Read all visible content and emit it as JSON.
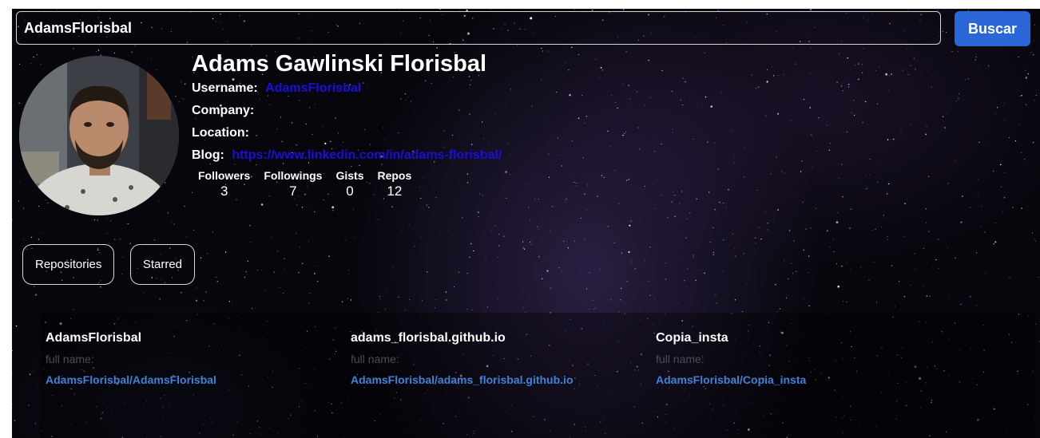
{
  "search": {
    "value": "AdamsFlorisbal",
    "button_label": "Buscar"
  },
  "profile": {
    "name": "Adams Gawlinski Florisbal",
    "username_label": "Username:",
    "username": "AdamsFlorisbal",
    "company_label": "Company:",
    "company": "",
    "location_label": "Location:",
    "location": "",
    "blog_label": "Blog:",
    "blog": "https://www.linkedin.com/in/adams-florisbal/"
  },
  "stats": [
    {
      "label": "Followers",
      "value": "3"
    },
    {
      "label": "Followings",
      "value": "7"
    },
    {
      "label": "Gists",
      "value": "0"
    },
    {
      "label": "Repos",
      "value": "12"
    }
  ],
  "tabs": [
    {
      "label": "Repositories"
    },
    {
      "label": "Starred"
    }
  ],
  "repos": [
    {
      "name": "AdamsFlorisbal",
      "fullname_label": "full name:",
      "link": "AdamsFlorisbal/AdamsFlorisbal"
    },
    {
      "name": "adams_florisbal.github.io",
      "fullname_label": "full name:",
      "link": "AdamsFlorisbal/adams_florisbal.github.io"
    },
    {
      "name": "Copia_insta",
      "fullname_label": "full name:",
      "link": "AdamsFlorisbal/Copia_insta"
    }
  ],
  "colors": {
    "accent": "#2b66d9",
    "link": "#1a0fd9",
    "repo_link": "#3f83d6",
    "background": "#07060c"
  }
}
